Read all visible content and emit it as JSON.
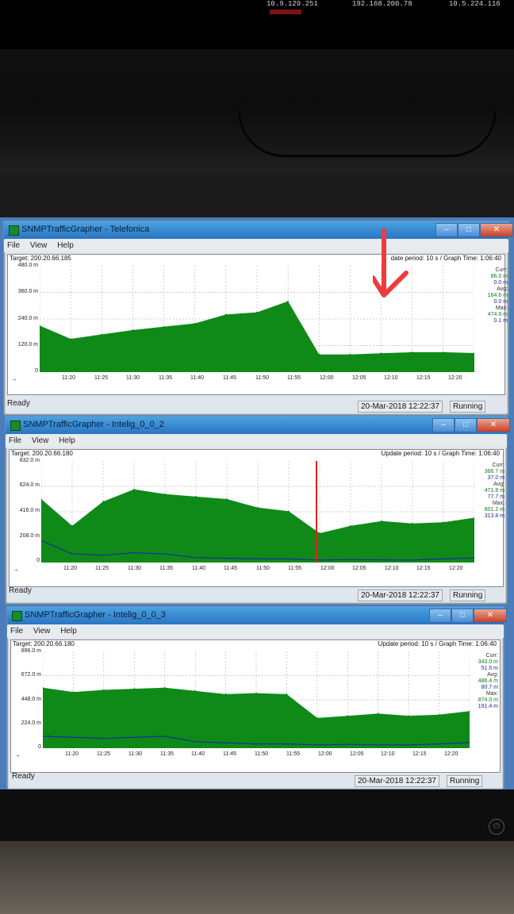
{
  "environment": {
    "ip_addresses": [
      "10.9.129.251",
      "192.168.200.78",
      "10.5.224.116"
    ]
  },
  "windows": [
    {
      "title": "SNMPTrafficGrapher - Telefonica",
      "menu": [
        "File",
        "View",
        "Help"
      ],
      "target": "Target: 200.20.66.185",
      "period": "date period: 10 s / Graph Time: 1:06:40",
      "y_labels": [
        "480.0 m",
        "360.0 m",
        "240.0 m",
        "120.0 m",
        "0"
      ],
      "x_labels": [
        "11:20",
        "11:25",
        "11:30",
        "11:35",
        "11:40",
        "11:45",
        "11:50",
        "11:55",
        "12:00",
        "12:05",
        "12:10",
        "12:15",
        "12:20"
      ],
      "stats": {
        "curr_label": "Curr:",
        "curr_in": "86.0 m",
        "curr_out": "0.0 m",
        "avg_label": "Avg:",
        "avg_in": "164.6 m",
        "avg_out": "0.0 m",
        "max_label": "Max:",
        "max_in": "474.9 m",
        "max_out": "0.1 m"
      },
      "status": "Ready",
      "datetime": "20-Mar-2018 12:22:37",
      "state": "Running"
    },
    {
      "title": "SNMPTrafficGrapher - Intelig_0_0_2",
      "menu": [
        "File",
        "View",
        "Help"
      ],
      "target": "Target: 200.20.66.180",
      "period": "Update period: 10 s / Graph Time: 1:06:40",
      "y_labels": [
        "832.0 m",
        "624.0 m",
        "416.0 m",
        "208.0 m",
        "0"
      ],
      "x_labels": [
        "11:20",
        "11:25",
        "11:30",
        "11:35",
        "11:40",
        "11:45",
        "11:50",
        "11:55",
        "12:00",
        "12:05",
        "12:10",
        "12:15",
        "12:20"
      ],
      "stats": {
        "curr_label": "Curr:",
        "curr_in": "366.7 m",
        "curr_out": "37.0 m",
        "avg_label": "Avg:",
        "avg_in": "471.8 m",
        "avg_out": "77.7 m",
        "max_label": "Max:",
        "max_in": "801.2 m",
        "max_out": "313.8 m"
      },
      "status": "Ready",
      "datetime": "20-Mar-2018 12:22:37",
      "state": "Running"
    },
    {
      "title": "SNMPTrafficGrapher - Intelig_0_0_3",
      "menu": [
        "File",
        "View",
        "Help"
      ],
      "target": "Target: 200.20.66.180",
      "period": "Update period: 10 s / Graph Time: 1:06:40",
      "y_labels": [
        "896.0 m",
        "672.0 m",
        "448.0 m",
        "224.0 m",
        "0"
      ],
      "x_labels": [
        "11:20",
        "11:25",
        "11:30",
        "11:35",
        "11:40",
        "11:45",
        "11:50",
        "11:55",
        "12:00",
        "12:05",
        "12:10",
        "12:15",
        "12:20"
      ],
      "stats": {
        "curr_label": "Curr:",
        "curr_in": "343.0 m",
        "curr_out": "51.5 m",
        "avg_label": "Avg:",
        "avg_in": "486.4 m",
        "avg_out": "80.7 m",
        "max_label": "Max:",
        "max_in": "874.0 m",
        "max_out": "191.4 m"
      },
      "status": "Ready",
      "datetime": "20-Mar-2018 12:22:37",
      "state": "Running"
    }
  ],
  "chart_data": [
    {
      "type": "area",
      "ylim": [
        0,
        480
      ],
      "x": [
        "11:20",
        "11:25",
        "11:30",
        "11:35",
        "11:40",
        "11:45",
        "11:50",
        "11:55",
        "11:57",
        "12:00",
        "12:05",
        "12:10",
        "12:15",
        "12:20",
        "12:22"
      ],
      "series": [
        {
          "values": [
            210,
            150,
            170,
            190,
            205,
            220,
            260,
            270,
            320,
            80,
            80,
            85,
            90,
            90,
            86
          ]
        }
      ]
    },
    {
      "type": "area",
      "ylim": [
        0,
        832
      ],
      "x": [
        "11:20",
        "11:25",
        "11:30",
        "11:35",
        "11:40",
        "11:45",
        "11:50",
        "11:55",
        "11:57",
        "12:00",
        "12:05",
        "12:10",
        "12:15",
        "12:20",
        "12:22"
      ],
      "series": [
        {
          "values": [
            520,
            300,
            500,
            600,
            560,
            540,
            520,
            450,
            420,
            240,
            300,
            340,
            320,
            330,
            367
          ]
        },
        {
          "values": [
            180,
            70,
            60,
            80,
            70,
            40,
            35,
            30,
            30,
            20,
            25,
            22,
            20,
            30,
            37
          ]
        }
      ]
    },
    {
      "type": "area",
      "ylim": [
        0,
        896
      ],
      "x": [
        "11:20",
        "11:25",
        "11:30",
        "11:35",
        "11:40",
        "11:45",
        "11:50",
        "11:55",
        "11:57",
        "12:00",
        "12:05",
        "12:10",
        "12:15",
        "12:20",
        "12:22"
      ],
      "series": [
        {
          "values": [
            560,
            520,
            540,
            550,
            560,
            530,
            500,
            510,
            500,
            280,
            300,
            320,
            300,
            310,
            343
          ]
        },
        {
          "values": [
            110,
            100,
            90,
            100,
            110,
            60,
            50,
            40,
            40,
            30,
            35,
            30,
            30,
            40,
            52
          ]
        }
      ]
    }
  ],
  "colors": {
    "fill": "#0f8a18",
    "out_line": "#1a2fa0",
    "cursor": "#e02020",
    "annotation": "#ee3b3b"
  }
}
